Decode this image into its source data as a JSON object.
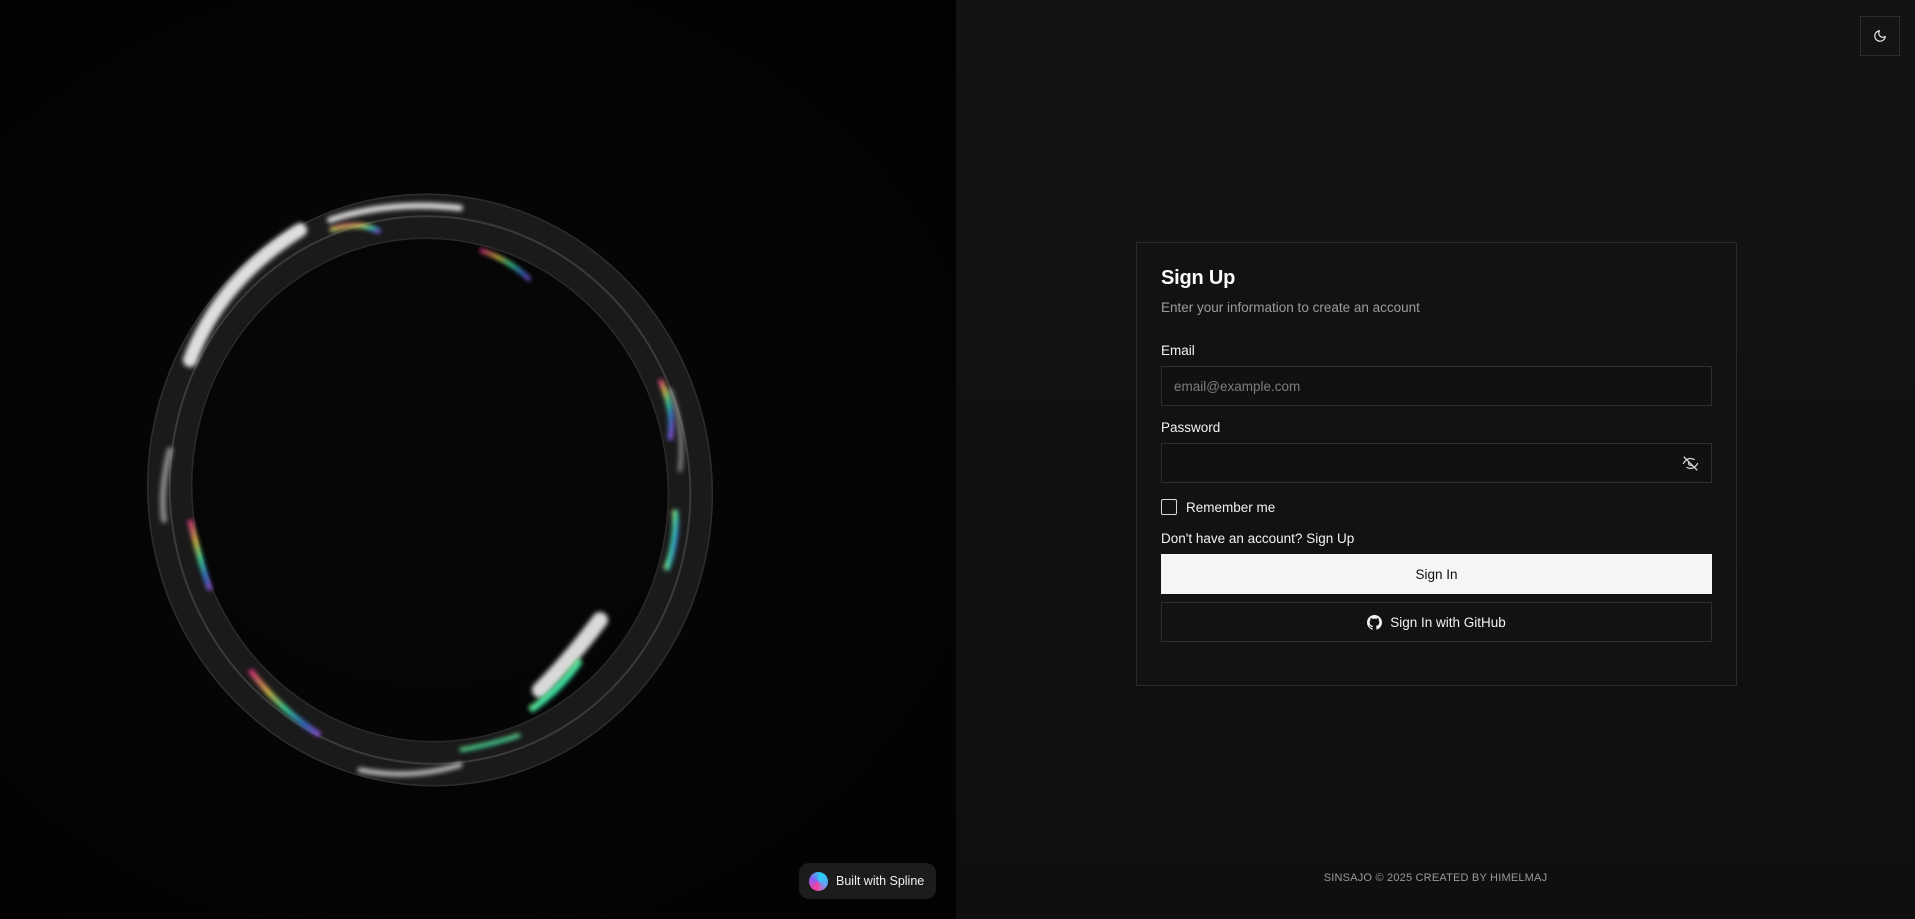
{
  "scene": {
    "badge_label": "Built with Spline",
    "icon": "spline-logo-icon"
  },
  "header": {
    "theme_toggle_icon": "moon-icon"
  },
  "form": {
    "title": "Sign Up",
    "subtitle": "Enter your information to create an account",
    "email_label": "Email",
    "email_placeholder": "email@example.com",
    "email_value": "",
    "password_label": "Password",
    "password_value": "",
    "password_toggle_icon": "eye-off-icon",
    "remember_label": "Remember me",
    "remember_checked": false,
    "signup_prompt": "Don't have an account?",
    "signup_link": "Sign Up",
    "signin_button": "Sign In",
    "github_button": "Sign In with GitHub",
    "github_icon": "github-icon"
  },
  "footer": {
    "text": "SINSAJO © 2025 CREATED BY HIMELMAJ"
  },
  "colors": {
    "background": "#0a0a0a",
    "card_border": "#2b2b2b",
    "primary_button": "#f5f5f5",
    "muted_text": "#9b9b9b"
  }
}
